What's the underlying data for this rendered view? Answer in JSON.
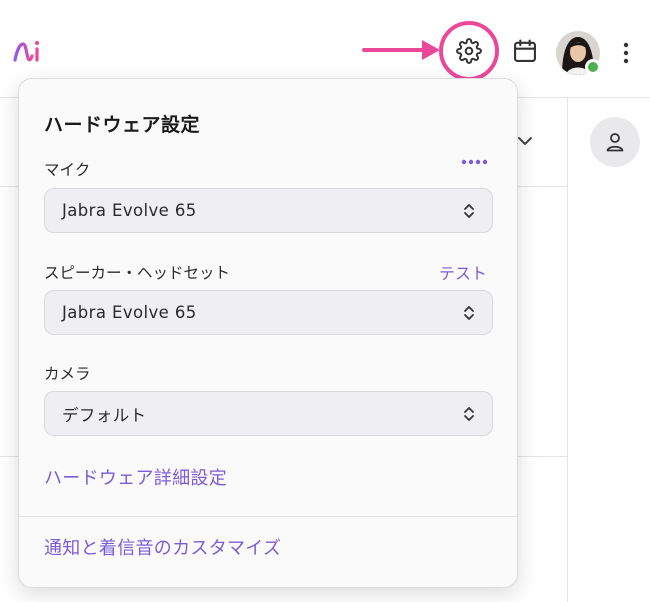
{
  "header": {
    "logo_icon": "ai-logo-icon",
    "settings_icon": "gear-icon",
    "calendar_icon": "calendar-icon",
    "more_icon": "more-vertical-icon",
    "status": "online",
    "highlight_color": "#ec4899"
  },
  "hardware_panel": {
    "title": "ハードウェア設定",
    "microphone": {
      "label": "マイク",
      "more_icon": "more-horizontal-icon",
      "selected": "Jabra Evolve 65"
    },
    "speaker": {
      "label": "スピーカー・ヘッドセット",
      "test_label": "テスト",
      "selected": "Jabra Evolve 65"
    },
    "camera": {
      "label": "カメラ",
      "selected": "デフォルト"
    },
    "advanced_link": "ハードウェア詳細設定",
    "notifications_link": "通知と着信音のカスタマイズ"
  },
  "colors": {
    "accent": "#7c5cd6",
    "status_online": "#4caf50"
  }
}
